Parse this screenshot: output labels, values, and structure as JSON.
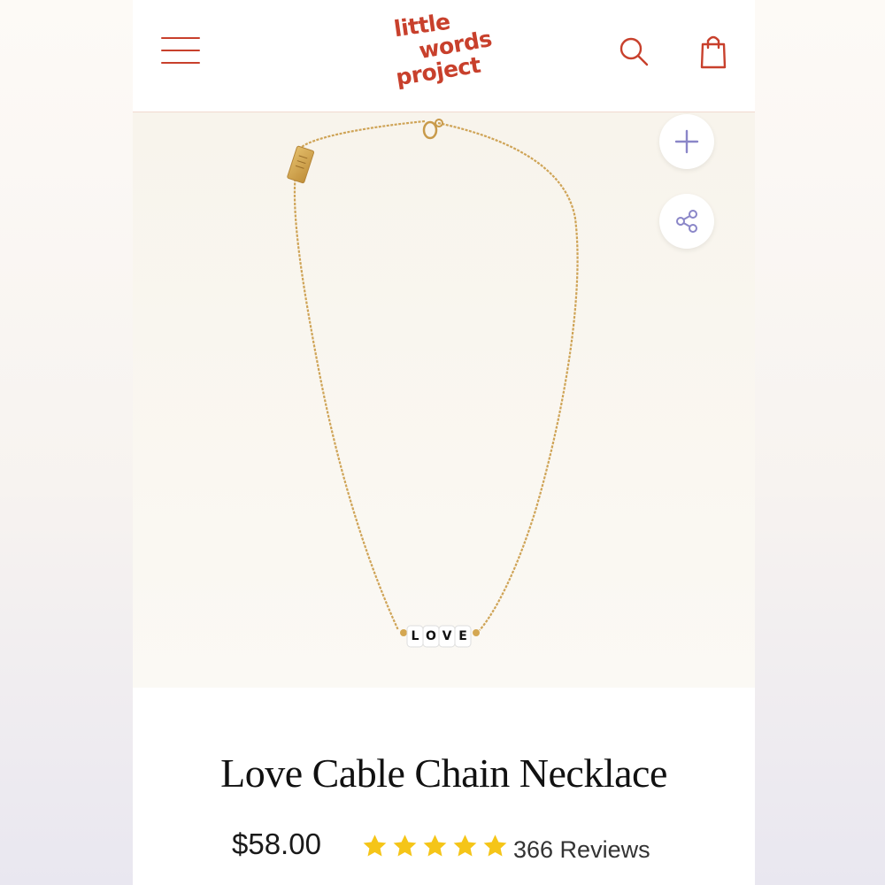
{
  "brand": {
    "logo_line1": "little",
    "logo_line2": "words",
    "logo_line3": "project",
    "color": "#c8402c"
  },
  "header": {
    "icons": [
      "menu-icon",
      "search-icon",
      "shopping-bag-icon"
    ]
  },
  "gallery": {
    "bead_letters": [
      "L",
      "O",
      "V",
      "E"
    ],
    "actions": [
      "plus-icon",
      "share-icon"
    ]
  },
  "product": {
    "title": "Love Cable Chain Necklace",
    "price": "$58.00",
    "rating": 5,
    "rating_max": 5,
    "reviews_label": "366 Reviews",
    "star_color": "#f5c518"
  }
}
